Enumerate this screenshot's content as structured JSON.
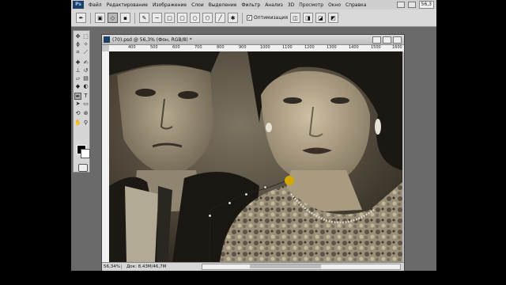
{
  "app": {
    "logo": "Ps",
    "menu": [
      "Файл",
      "Редактирование",
      "Изображение",
      "Слои",
      "Выделение",
      "Фильтр",
      "Анализ",
      "3D",
      "Просмотр",
      "Окно",
      "Справка"
    ],
    "zoom_select": "56,3"
  },
  "options_bar": {
    "antialias_label": "Оптимизация",
    "antialias_checked": "✓"
  },
  "document": {
    "title": "(70).psd @ 56,3% (Фон, RGB/8) *",
    "ruler_ticks": [
      "400",
      "500",
      "600",
      "700",
      "800",
      "900",
      "1000",
      "1100",
      "1200",
      "1300",
      "1400",
      "1500",
      "1600"
    ],
    "zoom": "56,34%",
    "doc_info": "Док: 8,43M/46,7M"
  },
  "colors": {
    "foreground": "#000000",
    "background": "#ffffff",
    "pen_anchor": "#d4a800"
  },
  "tools": [
    "move-tool",
    "marquee-tool",
    "lasso-tool",
    "quick-select-tool",
    "crop-tool",
    "eyedropper-tool",
    "healing-brush-tool",
    "brush-tool",
    "clone-stamp-tool",
    "history-brush-tool",
    "eraser-tool",
    "gradient-tool",
    "blur-tool",
    "dodge-tool",
    "pen-tool",
    "type-tool",
    "path-select-tool",
    "shape-tool",
    "3d-rotate-tool",
    "3d-orbit-tool",
    "hand-tool",
    "zoom-tool"
  ]
}
